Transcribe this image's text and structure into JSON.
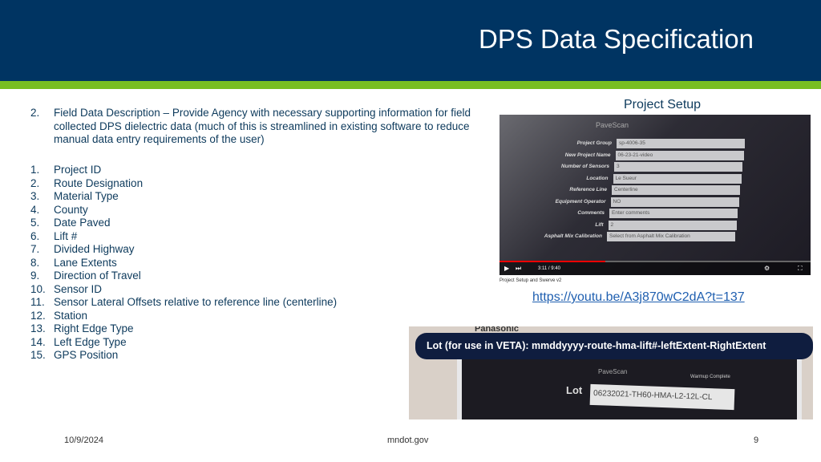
{
  "header": {
    "title": "DPS Data Specification",
    "bg_color": "#003462",
    "stripe_color": "#78be21"
  },
  "intro": {
    "number": "2.",
    "text": "Field Data Description – Provide Agency with necessary supporting information for field collected DPS dielectric data (much of this is streamlined in existing software to reduce manual data entry requirements of the user)"
  },
  "items": [
    {
      "n": "1.",
      "label": "Project ID"
    },
    {
      "n": "2.",
      "label": "Route Designation"
    },
    {
      "n": "3.",
      "label": "Material Type"
    },
    {
      "n": "4.",
      "label": "County"
    },
    {
      "n": "5.",
      "label": "Date Paved"
    },
    {
      "n": "6.",
      "label": "Lift #"
    },
    {
      "n": "7.",
      "label": "Divided Highway"
    },
    {
      "n": "8.",
      "label": "Lane Extents"
    },
    {
      "n": "9.",
      "label": "Direction of Travel"
    },
    {
      "n": "10.",
      "label": "Sensor ID"
    },
    {
      "n": "11.",
      "label": "Sensor Lateral Offsets relative to reference line (centerline)"
    },
    {
      "n": "12.",
      "label": "Station"
    },
    {
      "n": "13.",
      "label": "Right Edge Type"
    },
    {
      "n": "14.",
      "label": "Left Edge Type"
    },
    {
      "n": "15.",
      "label": "GPS Position"
    }
  ],
  "project_setup": {
    "caption": "Project Setup",
    "brand": "PaveScan",
    "fields": [
      {
        "label": "Project Group",
        "value": "sp-4006-35"
      },
      {
        "label": "New Project Name",
        "value": "06-23-21-video"
      },
      {
        "label": "Number of Sensors",
        "value": "3"
      },
      {
        "label": "Location",
        "value": "Le Sueur"
      },
      {
        "label": "Reference Line",
        "value": "Centerline"
      },
      {
        "label": "Equipment Operator",
        "value": "NO"
      },
      {
        "label": "Comments",
        "value": "Enter comments"
      },
      {
        "label": "Lift",
        "value": "2"
      },
      {
        "label": "Asphalt Mix Calibration",
        "value": "Select from Asphalt Mix Calibration"
      }
    ],
    "video_time": "3:11 / 9:40",
    "video_progress": 0.34,
    "video_title": "Project Setup and Swerve v2",
    "link": "https://youtu.be/A3j870wC2dA?t=137"
  },
  "lot_shot": {
    "device_brand": "Panasonic",
    "banner": "Lot (for use in VETA): mmddyyyy-route-hma-lift#-leftExtent-RightExtent",
    "brand": "PaveScan",
    "status": "Warmup Complete",
    "lot_label": "Lot",
    "lot_value": "06232021-TH60-HMA-L2-12L-CL"
  },
  "footer": {
    "date": "10/9/2024",
    "site": "mndot.gov",
    "page": "9"
  }
}
